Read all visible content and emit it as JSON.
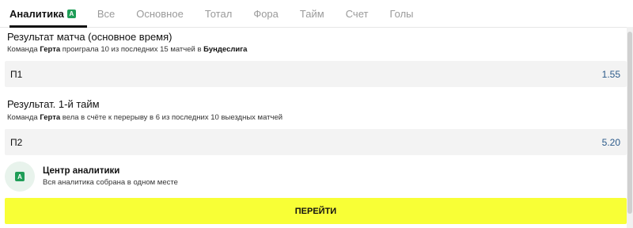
{
  "tabs": [
    {
      "label": "Аналитика",
      "badge": "A"
    },
    {
      "label": "Все"
    },
    {
      "label": "Основное"
    },
    {
      "label": "Тотал"
    },
    {
      "label": "Фора"
    },
    {
      "label": "Тайм"
    },
    {
      "label": "Счет"
    },
    {
      "label": "Голы"
    }
  ],
  "sections": [
    {
      "title": "Результат матча (основное время)",
      "sub_prefix": "Команда ",
      "sub_team": "Герта",
      "sub_middle": " проиграла 10 из последних 15 матчей в ",
      "sub_league": "Бундеслига",
      "sub_suffix": "",
      "odds_label": "П1",
      "odds_value": "1.55"
    },
    {
      "title": "Результат. 1-й тайм",
      "sub_prefix": "Команда ",
      "sub_team": "Герта",
      "sub_middle": " вела в счёте к перерыву в 6 из последних 10 выездных матчей",
      "sub_league": "",
      "sub_suffix": "",
      "odds_label": "П2",
      "odds_value": "5.20"
    }
  ],
  "analytics_center": {
    "icon_letter": "A",
    "title": "Центр аналитики",
    "subtitle": "Вся аналитика собрана в одном месте"
  },
  "go_button": {
    "label": "ПЕРЕЙТИ"
  },
  "colors": {
    "accent_green": "#1f9d57",
    "button_yellow": "#f8ff36",
    "odds_blue": "#2b5a8a"
  }
}
